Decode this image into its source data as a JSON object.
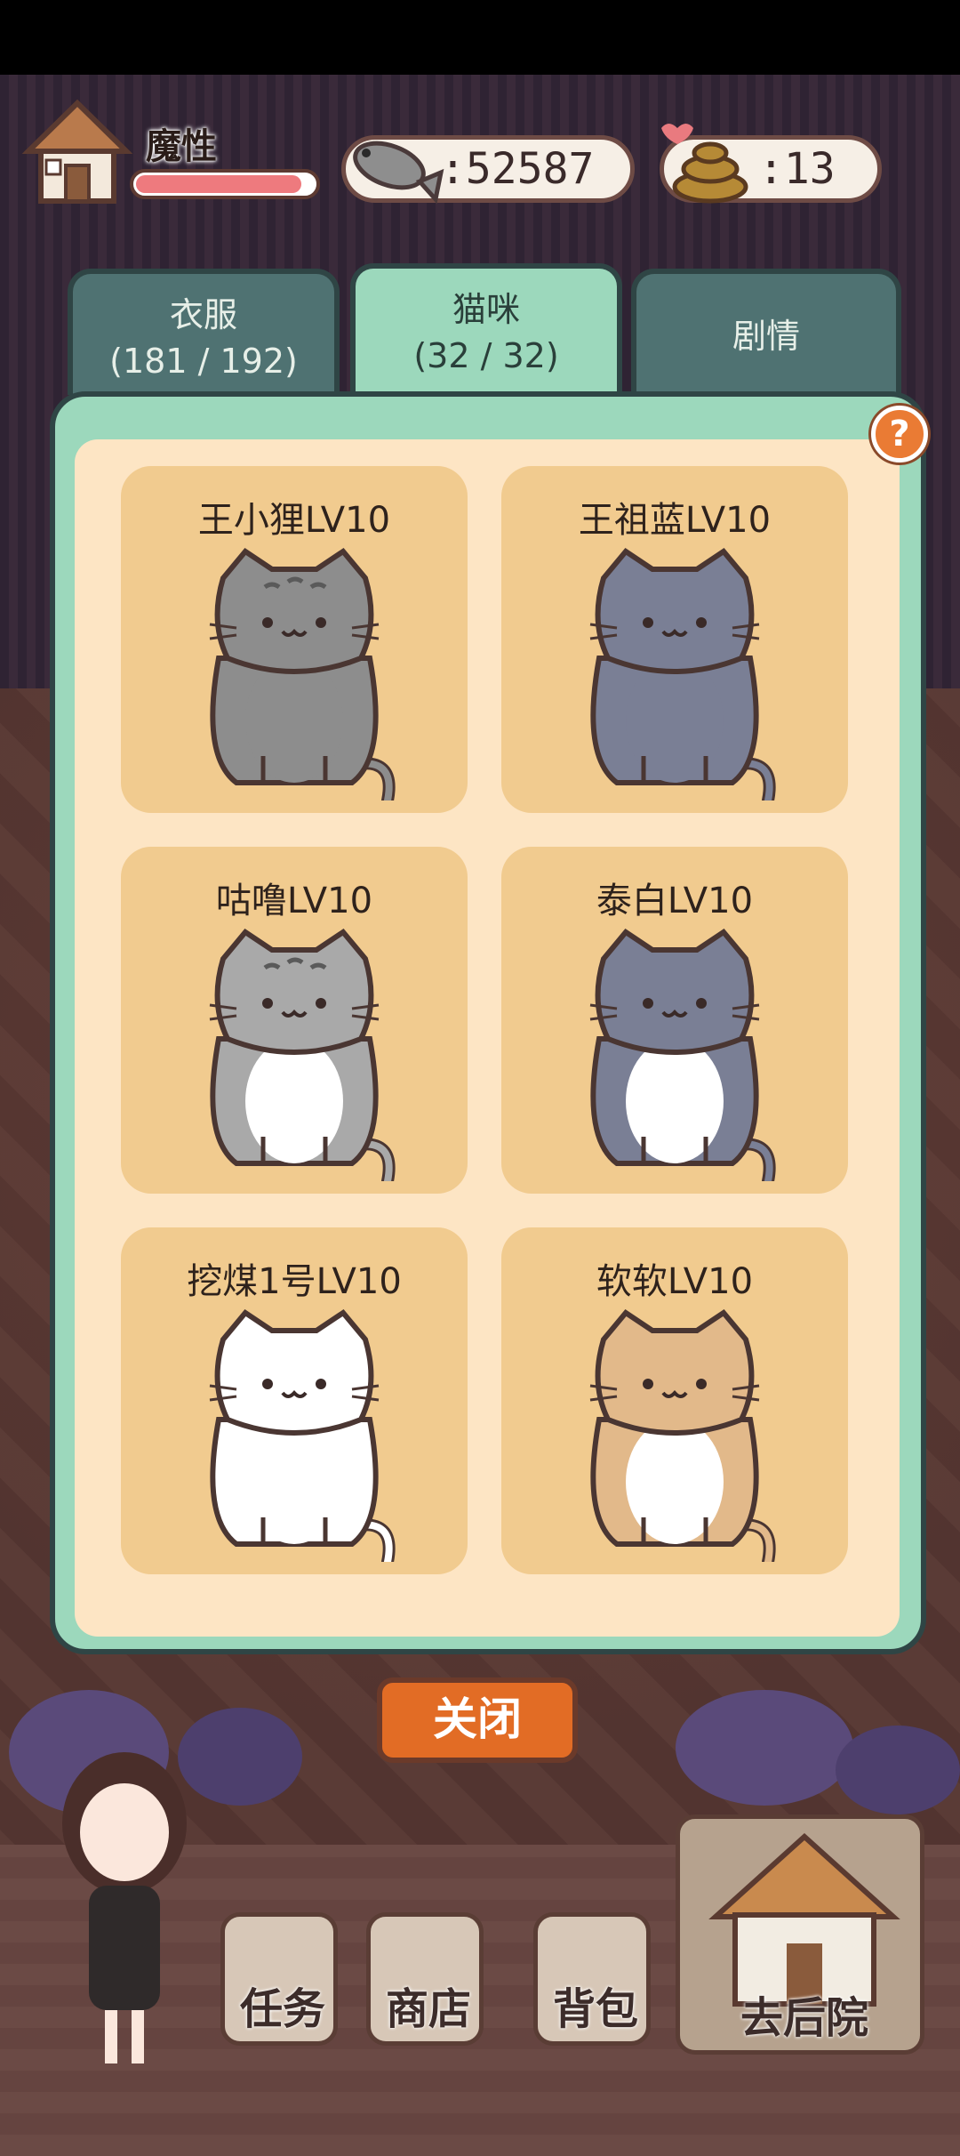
{
  "hud": {
    "player_name": "魔性",
    "hp_fraction": 0.93,
    "fish_count": ":52587",
    "poop_count": ":13"
  },
  "tabs": [
    {
      "label": "衣服",
      "sub": "(181 / 192)"
    },
    {
      "label": "猫咪",
      "sub": "(32 / 32)"
    },
    {
      "label": "剧情",
      "sub": ""
    }
  ],
  "help_label": "?",
  "cats": [
    {
      "name": "王小狸LV10",
      "fur": "#8d8d8d",
      "belly": "#8d8d8d",
      "stripes": true
    },
    {
      "name": "王祖蓝LV10",
      "fur": "#7a7f95",
      "belly": "#7a7f95",
      "stripes": false
    },
    {
      "name": "咕噜LV10",
      "fur": "#a9a9a9",
      "belly": "#ffffff",
      "stripes": true
    },
    {
      "name": "泰白LV10",
      "fur": "#7a7f95",
      "belly": "#ffffff",
      "stripes": false
    },
    {
      "name": "挖煤1号LV10",
      "fur": "#ffffff",
      "belly": "#ffffff",
      "stripes": false
    },
    {
      "name": "软软LV10",
      "fur": "#e2b98a",
      "belly": "#ffffff",
      "stripes": false
    }
  ],
  "close_label": "关闭",
  "nav": {
    "tasks": "任务",
    "shop": "商店",
    "bag": "背包",
    "yard": "去后院"
  },
  "colors": {
    "panel_green": "#9cd8bc",
    "panel_cream": "#fde5c4",
    "card": "#f1cb8f",
    "accent_orange": "#e26c25"
  }
}
